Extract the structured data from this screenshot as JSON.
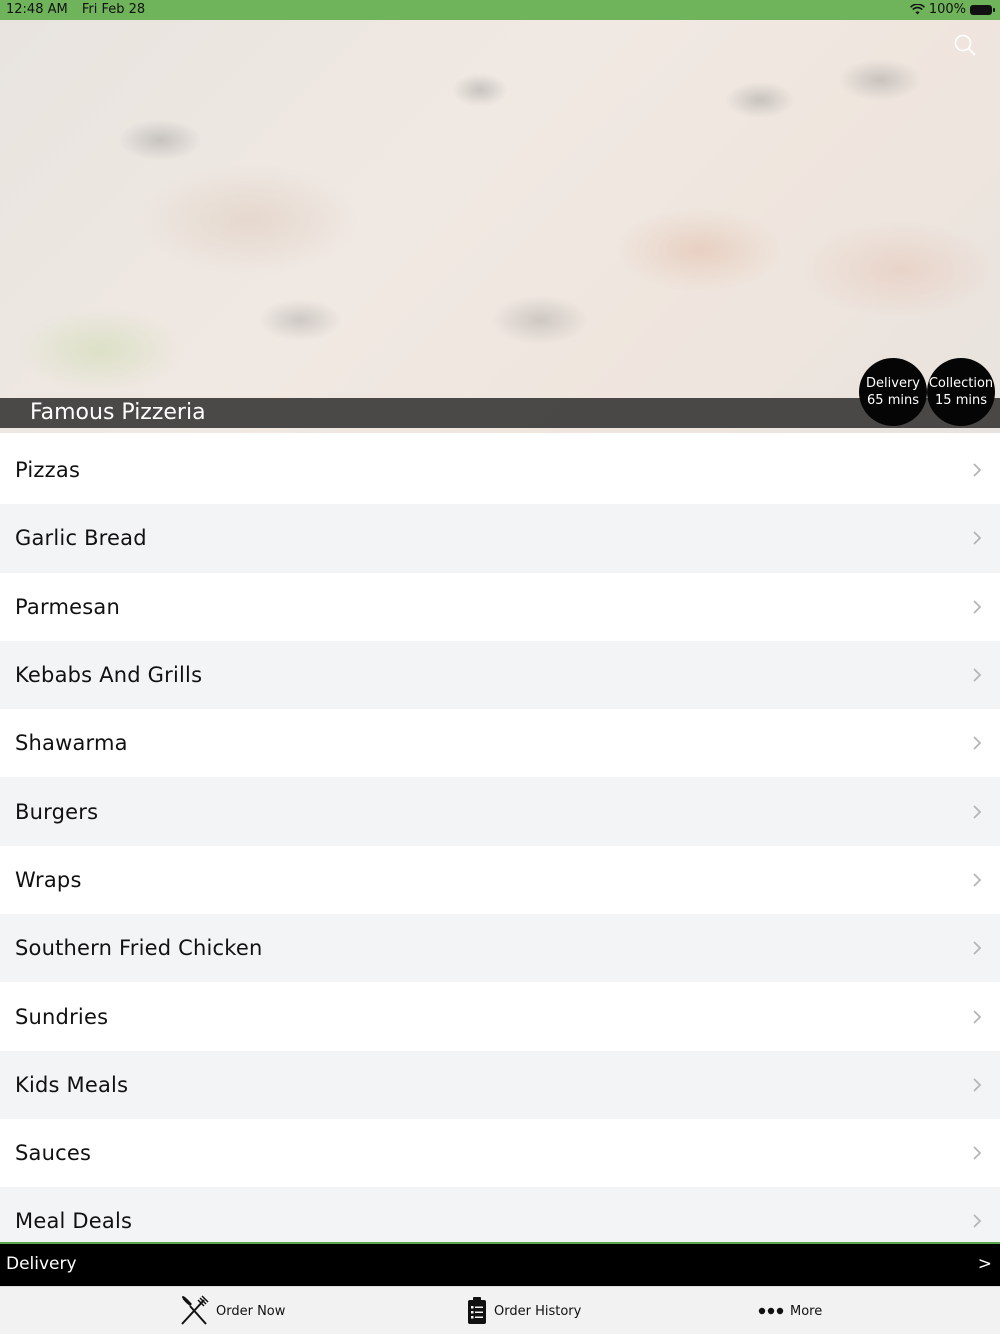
{
  "status": {
    "time": "12:48 AM",
    "date": "Fri Feb 28",
    "battery": "100%"
  },
  "header": {
    "restaurant_name": "Famous Pizzeria",
    "delivery": {
      "label": "Delivery",
      "time": "65 mins"
    },
    "collection": {
      "label": "Collection",
      "time": "15 mins"
    }
  },
  "menu": {
    "items": [
      {
        "label": "Pizzas"
      },
      {
        "label": "Garlic Bread"
      },
      {
        "label": "Parmesan"
      },
      {
        "label": "Kebabs And Grills"
      },
      {
        "label": "Shawarma"
      },
      {
        "label": "Burgers"
      },
      {
        "label": "Wraps"
      },
      {
        "label": "Southern Fried Chicken"
      },
      {
        "label": "Sundries"
      },
      {
        "label": "Kids Meals"
      },
      {
        "label": "Sauces"
      },
      {
        "label": "Meal Deals"
      }
    ]
  },
  "order_bar": {
    "label": "Delivery",
    "arrow": ">"
  },
  "tabs": {
    "order_now": "Order Now",
    "order_history": "Order History",
    "more": "More"
  },
  "colors": {
    "status_bar": "#6fb35a",
    "accent_green": "#59a84a",
    "pill_bg": "#050505"
  },
  "icons": [
    "wifi-icon",
    "battery-icon",
    "search-icon",
    "chevron-right-icon",
    "fork-knife-icon",
    "clipboard-icon",
    "more-dots-icon"
  ]
}
